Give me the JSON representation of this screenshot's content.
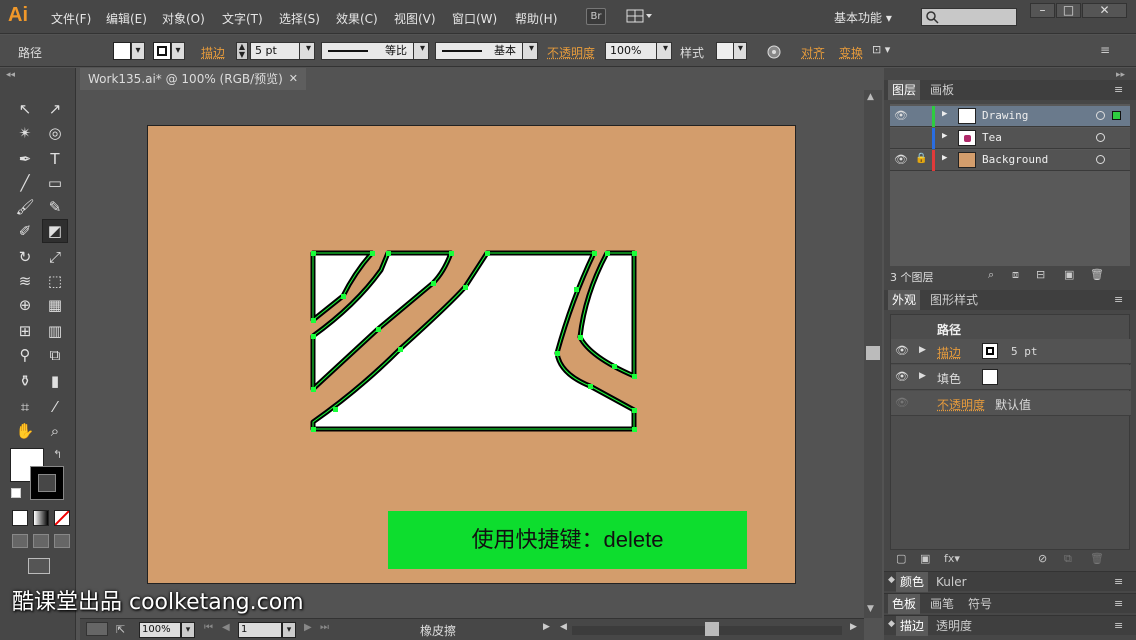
{
  "app": {
    "logo": "Ai",
    "br_button": "Br",
    "workspace": "基本功能"
  },
  "menus": [
    "文件(F)",
    "编辑(E)",
    "对象(O)",
    "文字(T)",
    "选择(S)",
    "效果(C)",
    "视图(V)",
    "窗口(W)",
    "帮助(H)"
  ],
  "control_bar": {
    "object_type": "路径",
    "stroke_label": "描边",
    "stroke_value": "5 pt",
    "profile_label": "等比",
    "brush_label": "基本",
    "opacity_label": "不透明度",
    "opacity_value": "100%",
    "style_label": "样式",
    "align_label": "对齐",
    "transform_label": "变换"
  },
  "document": {
    "tab_title": "Work135.ai* @ 100% (RGB/预览)"
  },
  "overlay": {
    "shortcut_text": "使用快捷键：delete"
  },
  "watermark": "酷课堂出品 coolketang.com",
  "status": {
    "zoom": "100%",
    "page": "1",
    "tool_name": "橡皮擦"
  },
  "layers_panel": {
    "tabs": [
      "图层",
      "画板"
    ],
    "layers": [
      {
        "name": "Drawing",
        "color": "#2ecc40",
        "visible": true,
        "locked": false
      },
      {
        "name": "Tea",
        "color": "#2a6de0",
        "visible": false,
        "locked": false
      },
      {
        "name": "Background",
        "color": "#e03a3a",
        "visible": true,
        "locked": true
      }
    ],
    "count_label": "3 个图层"
  },
  "appearance_panel": {
    "tabs": [
      "外观",
      "图形样式"
    ],
    "header": "路径",
    "stroke_label": "描边",
    "stroke_value": "5 pt",
    "fill_label": "填色",
    "opacity_label": "不透明度",
    "opacity_value": "默认值"
  },
  "bottom_panels": {
    "row1": [
      "颜色",
      "Kuler"
    ],
    "row2": [
      "色板",
      "画笔",
      "符号"
    ],
    "row3": [
      "描边",
      "透明度"
    ]
  },
  "colors": {
    "artboard": "#d39d6c",
    "accent": "#e69b3c",
    "overlay": "#0ddd2e"
  }
}
